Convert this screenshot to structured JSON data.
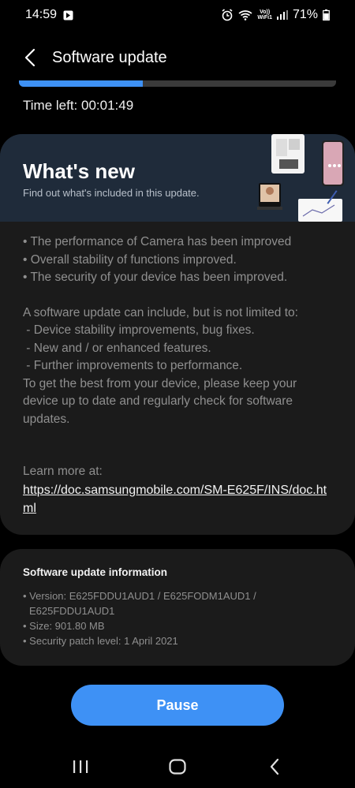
{
  "status_bar": {
    "time": "14:59",
    "volte_line1": "Vo))",
    "volte_line2": "WiFi1",
    "battery": "71%"
  },
  "header": {
    "title": "Software update",
    "back_icon": "back-arrow-icon"
  },
  "download": {
    "progress": 0.39,
    "time_left": "Time left: 00:01:49"
  },
  "whats_new": {
    "title": "What's new",
    "subtitle": "Find out what's included in this update.",
    "changes": [
      "• The performance of Camera has been improved",
      "• Overall stability of functions improved.",
      "• The security of your device has been improved."
    ],
    "intro": "A software update can include, but is not limited to:",
    "items": [
      " - Device stability improvements, bug fixes.",
      " - New and / or enhanced features.",
      " - Further improvements to performance."
    ],
    "advice": "To get the best from your device, please keep your device up to date and regularly check for software updates.",
    "learn_more": "Learn more at:",
    "link": "https://doc.samsungmobile.com/SM-E625F/INS/doc.html"
  },
  "info": {
    "title": "Software update information",
    "version_line1": "• Version: E625FDDU1AUD1 / E625FODM1AUD1 /",
    "version_line2": "E625FDDU1AUD1",
    "size": "• Size: 901.80 MB",
    "patch": "• Security patch level: 1 April 2021"
  },
  "pause_label": "Pause",
  "colors": {
    "accent": "#3e91f5",
    "card": "#1b1b1b",
    "banner": "#1f2b3a"
  }
}
